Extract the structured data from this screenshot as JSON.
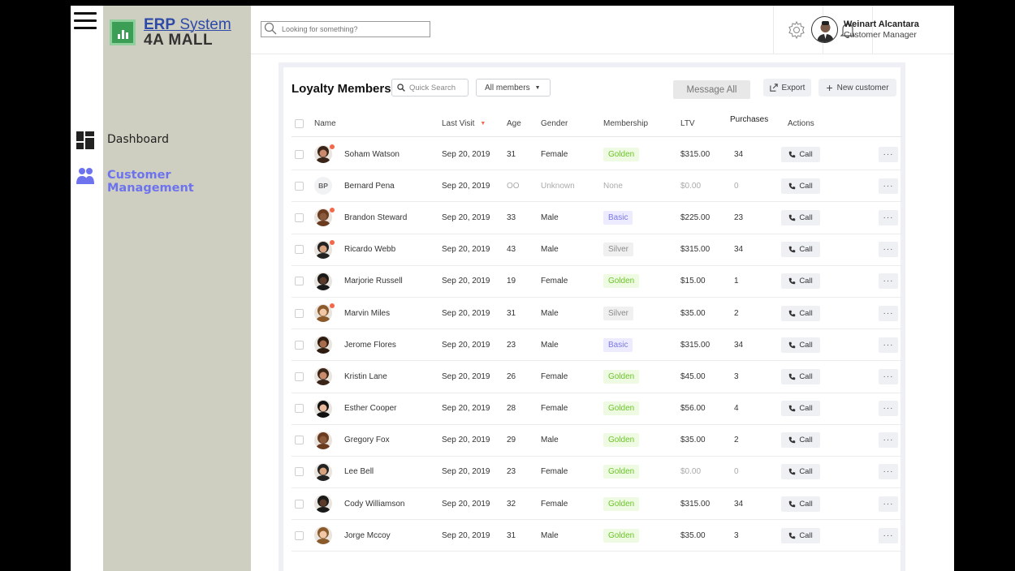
{
  "app": {
    "brand_line1_bold": "ERP",
    "brand_line1_rest": " System",
    "brand_line2": "4A MALL"
  },
  "sidebar": {
    "items": [
      {
        "label": "Dashboard",
        "icon": "dashboard-icon",
        "active": false
      },
      {
        "label": "Customer Management",
        "icon": "users-icon",
        "active": true
      }
    ]
  },
  "topbar": {
    "search_placeholder": "Looking for something?",
    "user_name": "Weinart Alcantara",
    "user_role": "Customer Manager"
  },
  "panel": {
    "title": "Loyalty Members",
    "quick_search": "Quick Search",
    "filter_label": "All members",
    "message_all": "Message All",
    "export": "Export",
    "new_customer": "New customer"
  },
  "table": {
    "columns": {
      "name": "Name",
      "last_visit": "Last Visit",
      "age": "Age",
      "gender": "Gender",
      "membership": "Membership",
      "ltv": "LTV",
      "purchases": "Purchases",
      "actions": "Actions"
    },
    "call_label": "Call",
    "more_label": "···",
    "rows": [
      {
        "name": "Soham Watson",
        "last_visit": "Sep 20, 2019",
        "age": "31",
        "gender": "Female",
        "membership": "Golden",
        "ltv": "$315.00",
        "purchases": "34",
        "avatar": "photo",
        "online": true,
        "muted": false
      },
      {
        "name": "Bernard Pena",
        "last_visit": "Sep 20, 2019",
        "age": "OO",
        "gender": "Unknown",
        "membership": "None",
        "ltv": "$0.00",
        "purchases": "0",
        "avatar": "initials",
        "initials": "BP",
        "online": false,
        "muted": true
      },
      {
        "name": "Brandon Steward",
        "last_visit": "Sep 20, 2019",
        "age": "33",
        "gender": "Male",
        "membership": "Basic",
        "ltv": "$225.00",
        "purchases": "23",
        "avatar": "photo",
        "online": true,
        "muted": false
      },
      {
        "name": "Ricardo Webb",
        "last_visit": "Sep 20, 2019",
        "age": "43",
        "gender": "Male",
        "membership": "Silver",
        "ltv": "$315.00",
        "purchases": "34",
        "avatar": "photo",
        "online": true,
        "muted": false
      },
      {
        "name": "Marjorie Russell",
        "last_visit": "Sep 20, 2019",
        "age": "19",
        "gender": "Female",
        "membership": "Golden",
        "ltv": "$15.00",
        "purchases": "1",
        "avatar": "photo",
        "online": false,
        "muted": false
      },
      {
        "name": "Marvin Miles",
        "last_visit": "Sep 20, 2019",
        "age": "31",
        "gender": "Male",
        "membership": "Silver",
        "ltv": "$35.00",
        "purchases": "2",
        "avatar": "photo",
        "online": true,
        "muted": false
      },
      {
        "name": "Jerome Flores",
        "last_visit": "Sep 20, 2019",
        "age": "23",
        "gender": "Male",
        "membership": "Basic",
        "ltv": "$315.00",
        "purchases": "34",
        "avatar": "photo",
        "online": false,
        "muted": false
      },
      {
        "name": "Kristin Lane",
        "last_visit": "Sep 20, 2019",
        "age": "26",
        "gender": "Female",
        "membership": "Golden",
        "ltv": "$45.00",
        "purchases": "3",
        "avatar": "photo",
        "online": false,
        "muted": false
      },
      {
        "name": "Esther Cooper",
        "last_visit": "Sep 20, 2019",
        "age": "28",
        "gender": "Female",
        "membership": "Golden",
        "ltv": "$56.00",
        "purchases": "4",
        "avatar": "photo",
        "online": false,
        "muted": false
      },
      {
        "name": "Gregory Fox",
        "last_visit": "Sep 20, 2019",
        "age": "29",
        "gender": "Male",
        "membership": "Golden",
        "ltv": "$35.00",
        "purchases": "2",
        "avatar": "photo",
        "online": false,
        "muted": false
      },
      {
        "name": "Lee Bell",
        "last_visit": "Sep 20, 2019",
        "age": "23",
        "gender": "Female",
        "membership": "Golden",
        "ltv": "$0.00",
        "purchases": "0",
        "avatar": "photo",
        "online": false,
        "muted": false,
        "ltv_muted": true
      },
      {
        "name": "Cody Williamson",
        "last_visit": "Sep 20, 2019",
        "age": "32",
        "gender": "Female",
        "membership": "Golden",
        "ltv": "$315.00",
        "purchases": "34",
        "avatar": "photo",
        "online": false,
        "muted": false
      },
      {
        "name": "Jorge Mccoy",
        "last_visit": "Sep 20, 2019",
        "age": "31",
        "gender": "Male",
        "membership": "Golden",
        "ltv": "$35.00",
        "purchases": "3",
        "avatar": "photo",
        "online": false,
        "muted": false
      }
    ]
  },
  "colors": {
    "accent": "#6d73ee",
    "sidebar_bg": "#cfcfc1",
    "golden_bg": "#eefbe2",
    "golden_fg": "#6cc42a",
    "basic_bg": "#ecebff",
    "basic_fg": "#7c78e8",
    "silver_bg": "#f0f0f0",
    "silver_fg": "#8a8a8a",
    "online_dot": "#f2694a"
  }
}
